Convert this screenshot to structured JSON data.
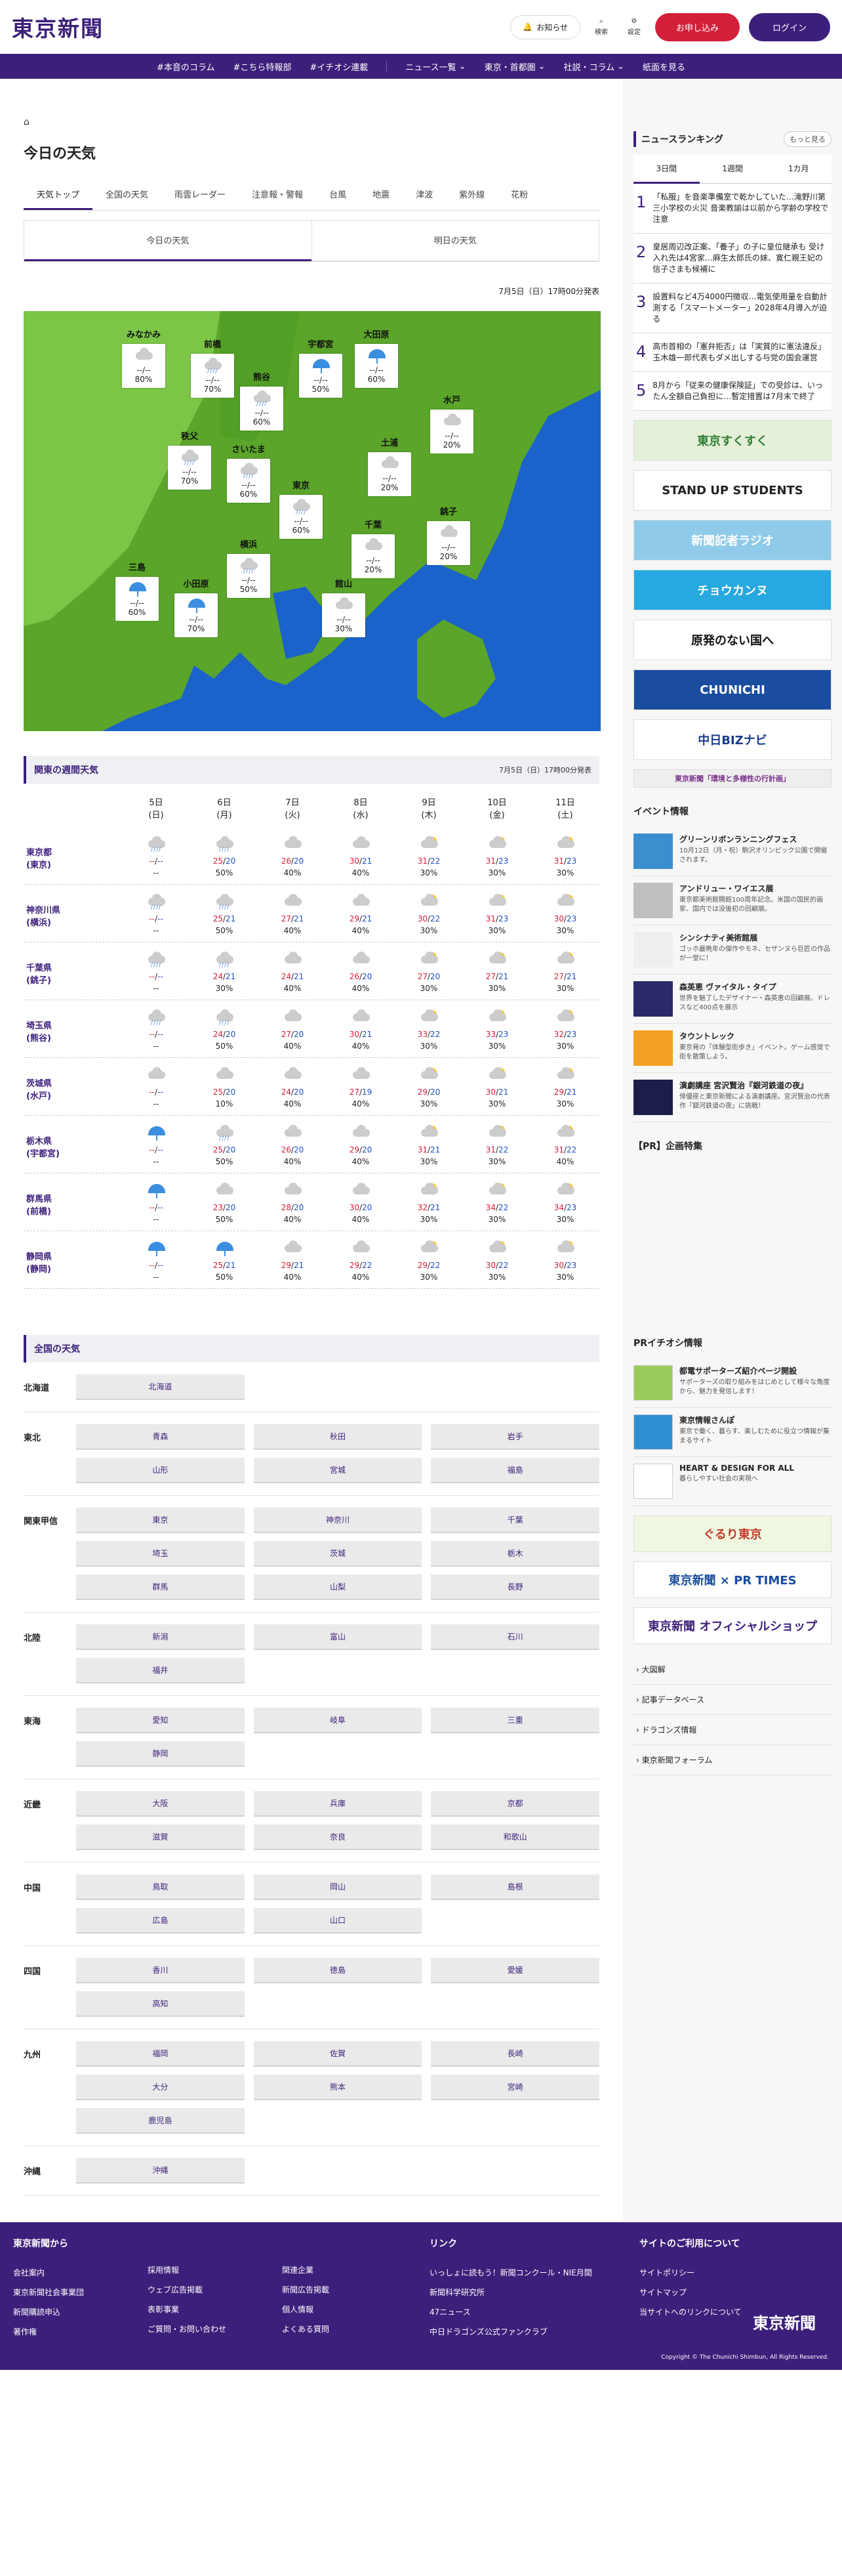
{
  "header": {
    "logo": "東京新聞",
    "notify": "お知らせ",
    "search": "検索",
    "settings": "設定",
    "subscribe": "お申し込み",
    "login": "ログイン"
  },
  "nav": [
    "#本音のコラム",
    "#こちら特報部",
    "#イチオシ連載",
    "ニュース一覧",
    "東京・首都圏",
    "社説・コラム",
    "紙面を見る"
  ],
  "page": {
    "title": "今日の天気",
    "tabs": [
      "天気トップ",
      "全国の天気",
      "雨雲レーダー",
      "注意報・警報",
      "台風",
      "地震",
      "津波",
      "紫外線",
      "花粉"
    ],
    "subtabs": [
      "今日の天気",
      "明日の天気"
    ],
    "announce": "7月5日（日）17時00分発表"
  },
  "map_cities": [
    {
      "name": "みなかみ",
      "icon": "cloud",
      "temp": "--/--",
      "pop": "80%"
    },
    {
      "name": "前橋",
      "icon": "rain",
      "temp": "--/--",
      "pop": "70%"
    },
    {
      "name": "熊谷",
      "icon": "rain",
      "temp": "--/--",
      "pop": "60%"
    },
    {
      "name": "宇都宮",
      "icon": "umbrella",
      "temp": "--/--",
      "pop": "50%"
    },
    {
      "name": "大田原",
      "icon": "umbrella",
      "temp": "--/--",
      "pop": "60%"
    },
    {
      "name": "水戸",
      "icon": "cloud",
      "temp": "--/--",
      "pop": "20%"
    },
    {
      "name": "秩父",
      "icon": "rain",
      "temp": "--/--",
      "pop": "70%"
    },
    {
      "name": "さいたま",
      "icon": "rain",
      "temp": "--/--",
      "pop": "60%"
    },
    {
      "name": "土浦",
      "icon": "cloud",
      "temp": "--/--",
      "pop": "20%"
    },
    {
      "name": "東京",
      "icon": "rain",
      "temp": "--/--",
      "pop": "60%"
    },
    {
      "name": "千葉",
      "icon": "cloud",
      "temp": "--/--",
      "pop": "20%"
    },
    {
      "name": "銚子",
      "icon": "cloud",
      "temp": "--/--",
      "pop": "20%"
    },
    {
      "name": "横浜",
      "icon": "rain",
      "temp": "--/--",
      "pop": "50%"
    },
    {
      "name": "三島",
      "icon": "umbrella",
      "temp": "--/--",
      "pop": "60%"
    },
    {
      "name": "小田原",
      "icon": "umbrella",
      "temp": "--/--",
      "pop": "70%"
    },
    {
      "name": "館山",
      "icon": "cloud",
      "temp": "--/--",
      "pop": "30%"
    }
  ],
  "weekly": {
    "title": "関東の週間天気",
    "announce": "7月5日（日）17時00分発表",
    "days": [
      {
        "d": "5日",
        "w": "(日)"
      },
      {
        "d": "6日",
        "w": "(月)"
      },
      {
        "d": "7日",
        "w": "(火)"
      },
      {
        "d": "8日",
        "w": "(水)"
      },
      {
        "d": "9日",
        "w": "(木)"
      },
      {
        "d": "10日",
        "w": "(金)"
      },
      {
        "d": "11日",
        "w": "(土)"
      }
    ],
    "prefs": [
      {
        "name": "東京都",
        "city": "(東京)",
        "cells": [
          [
            "rain",
            "--",
            "--",
            "--"
          ],
          [
            "rain",
            "25",
            "20",
            "50%"
          ],
          [
            "cloud",
            "26",
            "20",
            "40%"
          ],
          [
            "cloud",
            "30",
            "21",
            "40%"
          ],
          [
            "sun",
            "31",
            "22",
            "30%"
          ],
          [
            "sun",
            "31",
            "23",
            "30%"
          ],
          [
            "sun",
            "31",
            "23",
            "30%"
          ]
        ]
      },
      {
        "name": "神奈川県",
        "city": "(横浜)",
        "cells": [
          [
            "rain",
            "--",
            "--",
            "--"
          ],
          [
            "rain",
            "25",
            "21",
            "50%"
          ],
          [
            "cloud",
            "27",
            "21",
            "40%"
          ],
          [
            "cloud",
            "29",
            "21",
            "40%"
          ],
          [
            "sun",
            "30",
            "22",
            "30%"
          ],
          [
            "sun",
            "31",
            "23",
            "30%"
          ],
          [
            "sun",
            "30",
            "23",
            "30%"
          ]
        ]
      },
      {
        "name": "千葉県",
        "city": "(銚子)",
        "cells": [
          [
            "rain",
            "--",
            "--",
            "--"
          ],
          [
            "rain",
            "24",
            "21",
            "30%"
          ],
          [
            "cloud",
            "24",
            "21",
            "40%"
          ],
          [
            "cloud",
            "26",
            "20",
            "40%"
          ],
          [
            "sun",
            "27",
            "20",
            "30%"
          ],
          [
            "sun",
            "27",
            "21",
            "30%"
          ],
          [
            "sun",
            "27",
            "21",
            "30%"
          ]
        ]
      },
      {
        "name": "埼玉県",
        "city": "(熊谷)",
        "cells": [
          [
            "rain",
            "--",
            "--",
            "--"
          ],
          [
            "rain",
            "24",
            "20",
            "50%"
          ],
          [
            "cloud",
            "27",
            "20",
            "40%"
          ],
          [
            "cloud",
            "30",
            "21",
            "40%"
          ],
          [
            "sun",
            "33",
            "22",
            "30%"
          ],
          [
            "sun",
            "33",
            "23",
            "30%"
          ],
          [
            "sun",
            "32",
            "23",
            "30%"
          ]
        ]
      },
      {
        "name": "茨城県",
        "city": "(水戸)",
        "cells": [
          [
            "cloud",
            "--",
            "--",
            "--"
          ],
          [
            "cloud",
            "25",
            "20",
            "10%"
          ],
          [
            "cloud",
            "24",
            "20",
            "40%"
          ],
          [
            "cloud",
            "27",
            "19",
            "40%"
          ],
          [
            "sun",
            "29",
            "20",
            "30%"
          ],
          [
            "sun",
            "30",
            "21",
            "30%"
          ],
          [
            "sun",
            "29",
            "21",
            "30%"
          ]
        ]
      },
      {
        "name": "栃木県",
        "city": "(宇都宮)",
        "cells": [
          [
            "umbrella",
            "--",
            "--",
            "--"
          ],
          [
            "rain",
            "25",
            "20",
            "50%"
          ],
          [
            "cloud",
            "26",
            "20",
            "40%"
          ],
          [
            "cloud",
            "29",
            "20",
            "40%"
          ],
          [
            "sun",
            "31",
            "21",
            "30%"
          ],
          [
            "sun",
            "31",
            "22",
            "30%"
          ],
          [
            "sun",
            "31",
            "22",
            "40%"
          ]
        ]
      },
      {
        "name": "群馬県",
        "city": "(前橋)",
        "cells": [
          [
            "umbrella",
            "--",
            "--",
            "--"
          ],
          [
            "cloud",
            "23",
            "20",
            "50%"
          ],
          [
            "cloud",
            "28",
            "20",
            "40%"
          ],
          [
            "cloud",
            "30",
            "20",
            "40%"
          ],
          [
            "sun",
            "32",
            "21",
            "30%"
          ],
          [
            "sun",
            "34",
            "22",
            "30%"
          ],
          [
            "sun",
            "34",
            "23",
            "30%"
          ]
        ]
      },
      {
        "name": "静岡県",
        "city": "(静岡)",
        "cells": [
          [
            "umbrella",
            "--",
            "--",
            "--"
          ],
          [
            "umbrella",
            "25",
            "21",
            "50%"
          ],
          [
            "cloud",
            "29",
            "21",
            "40%"
          ],
          [
            "cloud",
            "29",
            "22",
            "40%"
          ],
          [
            "sun",
            "29",
            "22",
            "30%"
          ],
          [
            "sun",
            "30",
            "22",
            "30%"
          ],
          [
            "sun",
            "30",
            "23",
            "30%"
          ]
        ]
      }
    ]
  },
  "all": {
    "title": "全国の天気",
    "regions": [
      {
        "name": "北海道",
        "areas": [
          "北海道"
        ]
      },
      {
        "name": "東北",
        "areas": [
          "青森",
          "秋田",
          "岩手",
          "山形",
          "宮城",
          "福島"
        ]
      },
      {
        "name": "関東甲信",
        "areas": [
          "東京",
          "神奈川",
          "千葉",
          "埼玉",
          "茨城",
          "栃木",
          "群馬",
          "山梨",
          "長野"
        ]
      },
      {
        "name": "北陸",
        "areas": [
          "新潟",
          "富山",
          "石川",
          "福井"
        ]
      },
      {
        "name": "東海",
        "areas": [
          "愛知",
          "岐阜",
          "三重",
          "静岡"
        ]
      },
      {
        "name": "近畿",
        "areas": [
          "大阪",
          "兵庫",
          "京都",
          "滋賀",
          "奈良",
          "和歌山"
        ]
      },
      {
        "name": "中国",
        "areas": [
          "鳥取",
          "岡山",
          "島根",
          "広島",
          "山口"
        ]
      },
      {
        "name": "四国",
        "areas": [
          "香川",
          "徳島",
          "愛媛",
          "高知"
        ]
      },
      {
        "name": "九州",
        "areas": [
          "福岡",
          "佐賀",
          "長崎",
          "大分",
          "熊本",
          "宮崎",
          "鹿児島"
        ]
      },
      {
        "name": "沖縄",
        "areas": [
          "沖縄"
        ]
      }
    ]
  },
  "side": {
    "ranking_title": "ニュースランキング",
    "more": "もっと見る",
    "rank_tabs": [
      "3日間",
      "1週間",
      "1カ月"
    ],
    "ranking": [
      {
        "no": "1",
        "text": "「私服」を音楽準備室で乾かしていた…滝野川第三小学校の火災 音楽教諭は以前から学齢の学校で注意"
      },
      {
        "no": "2",
        "text": "皇居周辺改正案、「養子」の子に皇位継承も 受け入れ先は4宮家…麻生太郎氏の妹、寛仁親王妃の信子さまも候補に"
      },
      {
        "no": "3",
        "text": "設置料など4万4000円徴収…電気使用量を自動計測する「スマートメーター」2028年4月導入が迫る"
      },
      {
        "no": "4",
        "text": "高市首相の「憲弁拒否」は「実質的に憲法違反」 玉木雄一郎代表もダメ出しする与党の国会運営"
      },
      {
        "no": "5",
        "text": "8月から「従来の健康保険証」での受診は、いったん全額自己負担に…暫定措置は7月末で終了"
      }
    ],
    "banners": [
      "東京すくすく",
      "STAND UP STUDENTS",
      "新聞記者ラジオ",
      "チョウカンヌ",
      "原発のない国へ",
      "CHUNICHI",
      "中日BIZナビ",
      "東京新聞「環境と多様性の行計画」"
    ],
    "events_title": "イベント情報",
    "events": [
      {
        "t1": "グリーンリボンランニングフェス",
        "t2": "10月12日（月・祝）駒沢オリンピック公園で開催されます。"
      },
      {
        "t1": "アンドリュー・ワイエス展",
        "t2": "東京都美術館開館100周年記念。米国の国民的画家、国内では没後初の回顧展。"
      },
      {
        "t1": "シンシナティ美術館展",
        "t2": "ゴッホ最晩年の傑作やモネ、セザンヌら巨匠の作品が一堂に！"
      },
      {
        "t1": "森英恵 ヴァイタル・タイプ",
        "t2": "世界を魅了したデザイナー・森英恵の回顧展。ドレスなど400点を展示"
      },
      {
        "t1": "タウントレック",
        "t2": "東京発の「体験型街歩き」イベント。ゲーム感覚で街を散策しよう。"
      },
      {
        "t1": "演劇講座 宮沢賢治『銀河鉄道の夜』",
        "t2": "俳優座と東京新聞による演劇講座。宮沢賢治の代表作『銀河鉄道の夜』に挑戦！"
      }
    ],
    "pr_title": "【PR】企画特集",
    "pr2_title": "PRイチオシ情報",
    "pr2": [
      {
        "t1": "都電サポーターズ紹介ページ開設",
        "t2": "サポーターズの取り組みをはじめとして様々な角度から、魅力を発信します！"
      },
      {
        "t1": "東京情報さんぽ",
        "t2": "東京で働く、暮らす、楽しむために役立つ情報が集まるサイト"
      },
      {
        "t1": "HEART & DESIGN FOR ALL",
        "t2": "暮らしやすい社会の実現へ"
      }
    ],
    "banners2": [
      "ぐるり東京",
      "東京新聞 × PR TIMES",
      "東京新聞 オフィシャルショップ"
    ],
    "links": [
      "大図解",
      "記事データベース",
      "ドラゴンズ情報",
      "東京新聞フォーラム"
    ]
  },
  "footer": {
    "col1_title": "東京新聞から",
    "col1": [
      "会社案内",
      "東京新聞社会事業団",
      "新聞購読申込",
      "著作権"
    ],
    "col2": [
      "採用情報",
      "ウェブ広告掲載",
      "表彰事業",
      "ご質問・お問い合わせ"
    ],
    "col3": [
      "関連企業",
      "新聞広告掲載",
      "個人情報",
      "よくある質問"
    ],
    "col4_title": "リンク",
    "col4": [
      "いっしょに読もう！新聞コンクール・NIE月間",
      "新聞科学研究所",
      "47ニュース",
      "中日ドラゴンズ公式ファンクラブ"
    ],
    "col5_title": "サイトのご利用について",
    "col5": [
      "サイトポリシー",
      "サイトマップ",
      "当サイトへのリンクについて"
    ],
    "logo": "東京新聞",
    "copyright": "Copyright © The Chunichi Shimbun, All Rights Reserved."
  },
  "colors": {
    "brand": "#3c1f7a",
    "accent": "#d3203a",
    "sea": "#1b62ca",
    "land": "#5aa52a"
  }
}
